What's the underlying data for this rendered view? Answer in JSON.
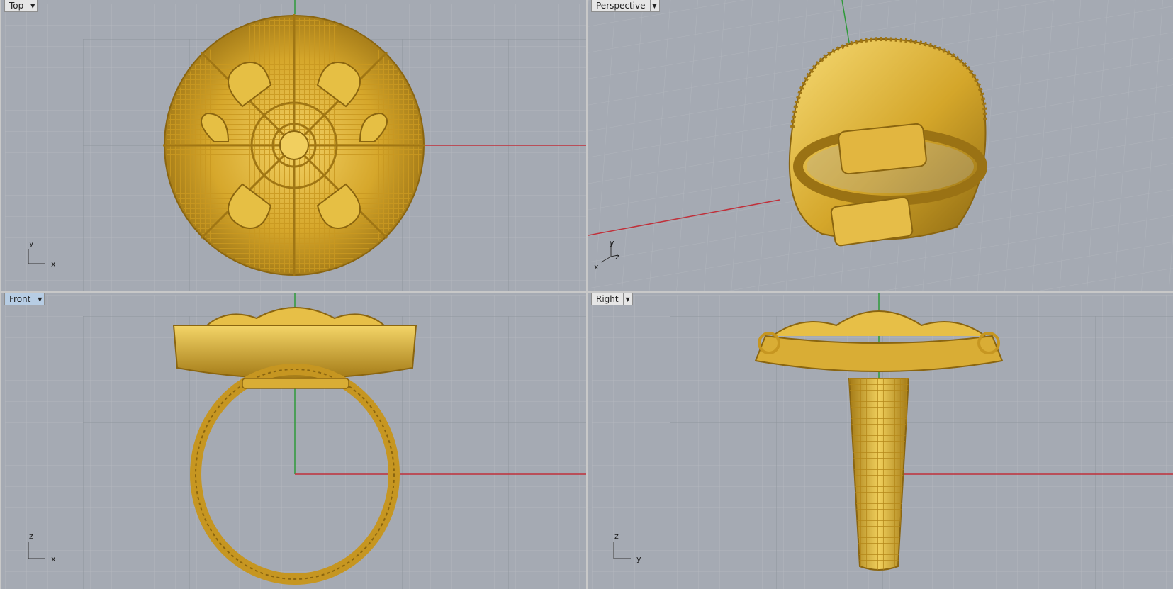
{
  "viewports": {
    "top": {
      "label": "Top",
      "axis_h": "x",
      "axis_v": "y",
      "active": false
    },
    "perspective": {
      "label": "Perspective",
      "axis_h": "z",
      "axis_v": "y",
      "axis_extra": "x",
      "active": false
    },
    "front": {
      "label": "Front",
      "axis_h": "x",
      "axis_v": "z",
      "active": true
    },
    "right": {
      "label": "Right",
      "axis_h": "y",
      "axis_v": "z",
      "active": false
    }
  },
  "icons": {
    "viewport_menu": "chevron-down-icon"
  },
  "colors": {
    "background": "#a5aab3",
    "grid_minor": "#b1b5bc",
    "grid_major": "#8f949c",
    "x_axis": "#c0303a",
    "y_axis": "#2f9a3a",
    "gold": "#d4a62a",
    "active_label": "#b7cde4"
  }
}
